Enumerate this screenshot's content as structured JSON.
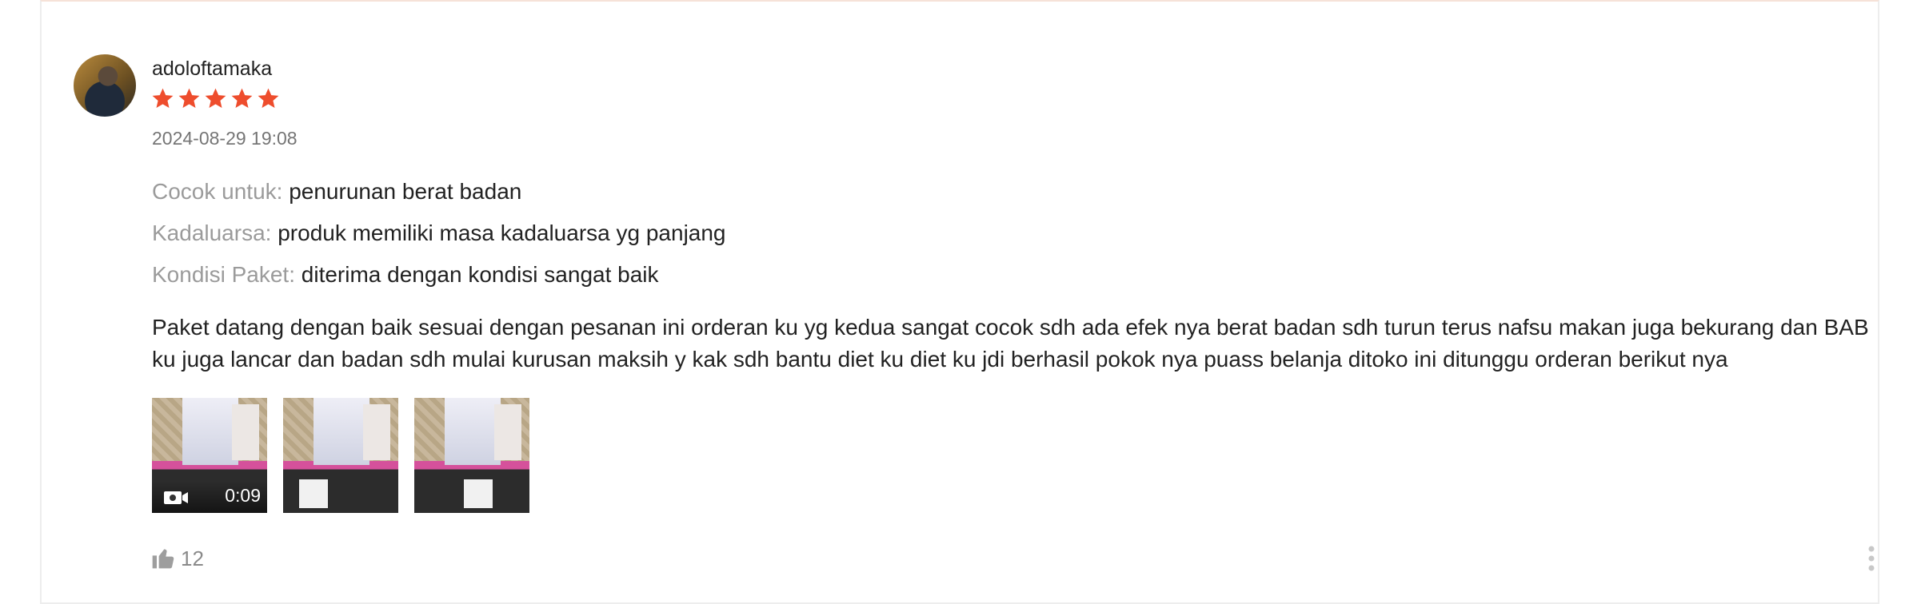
{
  "review": {
    "username": "adoloftamaka",
    "rating": 5,
    "max_rating": 5,
    "star_color": "#ee4d2d",
    "timestamp": "2024-08-29 19:08",
    "attributes": [
      {
        "label": "Cocok untuk:",
        "value": "penurunan berat badan"
      },
      {
        "label": "Kadaluarsa:",
        "value": "produk memiliki masa kadaluarsa yg panjang"
      },
      {
        "label": "Kondisi Paket:",
        "value": "diterima dengan kondisi sangat baik"
      }
    ],
    "text": "Paket datang dengan baik sesuai dengan pesanan ini orderan ku yg kedua sangat cocok sdh ada efek nya berat badan sdh turun terus nafsu makan juga bekurang dan BAB ku juga lancar dan badan sdh mulai kurusan maksih y kak sdh bantu diet ku diet ku jdi berhasil pokok nya puass belanja ditoko ini ditunggu orderan berikut nya",
    "media": {
      "video_duration": "0:09",
      "video_icon": "video-camera-icon"
    },
    "likes": "12",
    "icons": {
      "like": "thumbs-up-icon",
      "more": "more-vertical-icon",
      "star": "star-icon"
    }
  }
}
